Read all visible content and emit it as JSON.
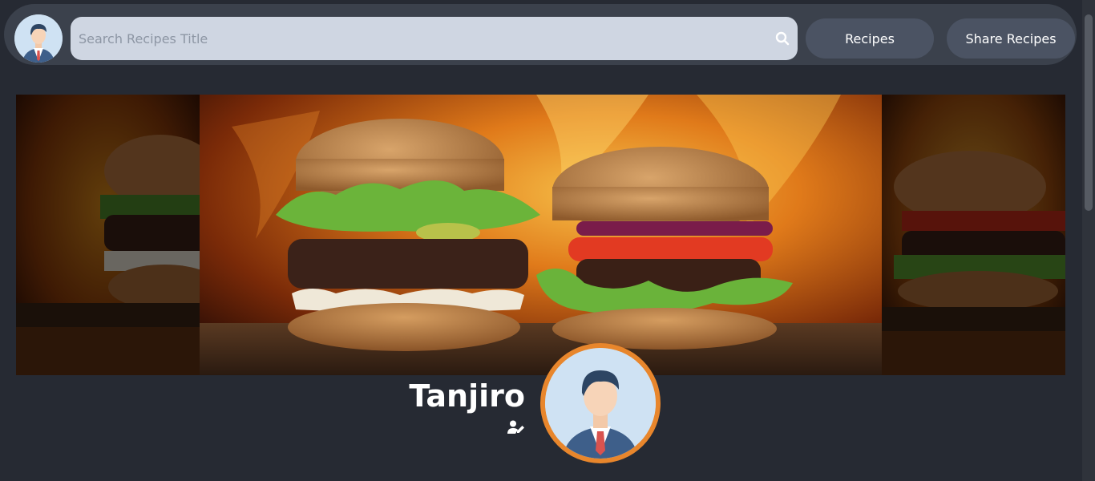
{
  "search": {
    "placeholder": "Search Recipes Title"
  },
  "nav": {
    "recipes_label": "Recipes",
    "share_label": "Share Recipes"
  },
  "profile": {
    "name": "Tanjiro"
  },
  "colors": {
    "accent_ring": "#e8862c",
    "navbar_bg": "#3b414c",
    "page_bg": "#262a33"
  },
  "icons": {
    "search": "search-icon",
    "edit_profile": "user-edit-icon"
  }
}
